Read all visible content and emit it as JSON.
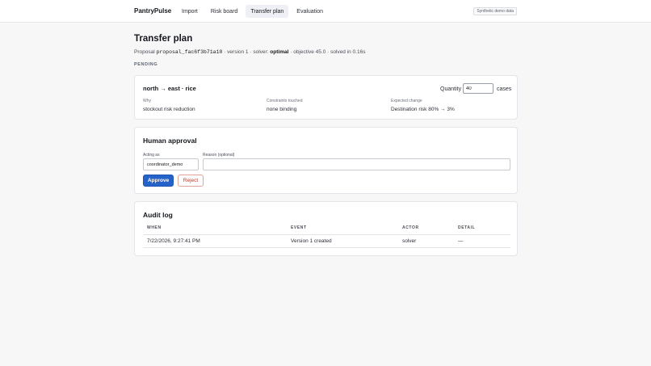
{
  "header": {
    "brand": "PantryPulse",
    "nav": [
      {
        "label": "Import"
      },
      {
        "label": "Risk board"
      },
      {
        "label": "Transfer plan"
      },
      {
        "label": "Evaluation"
      }
    ],
    "active_nav": "Transfer plan",
    "demo_badge": "Synthetic demo data"
  },
  "plan": {
    "title": "Transfer plan",
    "proposal_prefix": "Proposal",
    "proposal_id": "proposal_fac6f3b71a10",
    "version": "· version 1 · solver:",
    "solver_status": "optimal",
    "objective": "· objective 45.0 · solved in 0.16s",
    "status": "PENDING"
  },
  "transfer": {
    "route": "north → east · rice",
    "quantity_label": "Quantity",
    "quantity_value": "40",
    "quantity_unit": "cases",
    "why_label": "Why",
    "why_value": "stockout risk reduction",
    "constraints_label": "Constraints touched",
    "constraints_value": "none binding",
    "change_label": "Expected change",
    "change_value": "Destination risk 80% → 3%"
  },
  "approval": {
    "title": "Human approval",
    "acting_as_label": "Acting as",
    "acting_as_value": "coordinator_demo",
    "reason_label": "Reason (optional)",
    "reason_value": "",
    "approve_label": "Approve",
    "reject_label": "Reject"
  },
  "audit": {
    "title": "Audit log",
    "columns": [
      "WHEN",
      "EVENT",
      "ACTOR",
      "DETAIL"
    ],
    "rows": [
      {
        "when": "7/22/2026, 9:27:41 PM",
        "event": "Version 1 created",
        "actor": "solver",
        "detail": "—"
      }
    ]
  }
}
